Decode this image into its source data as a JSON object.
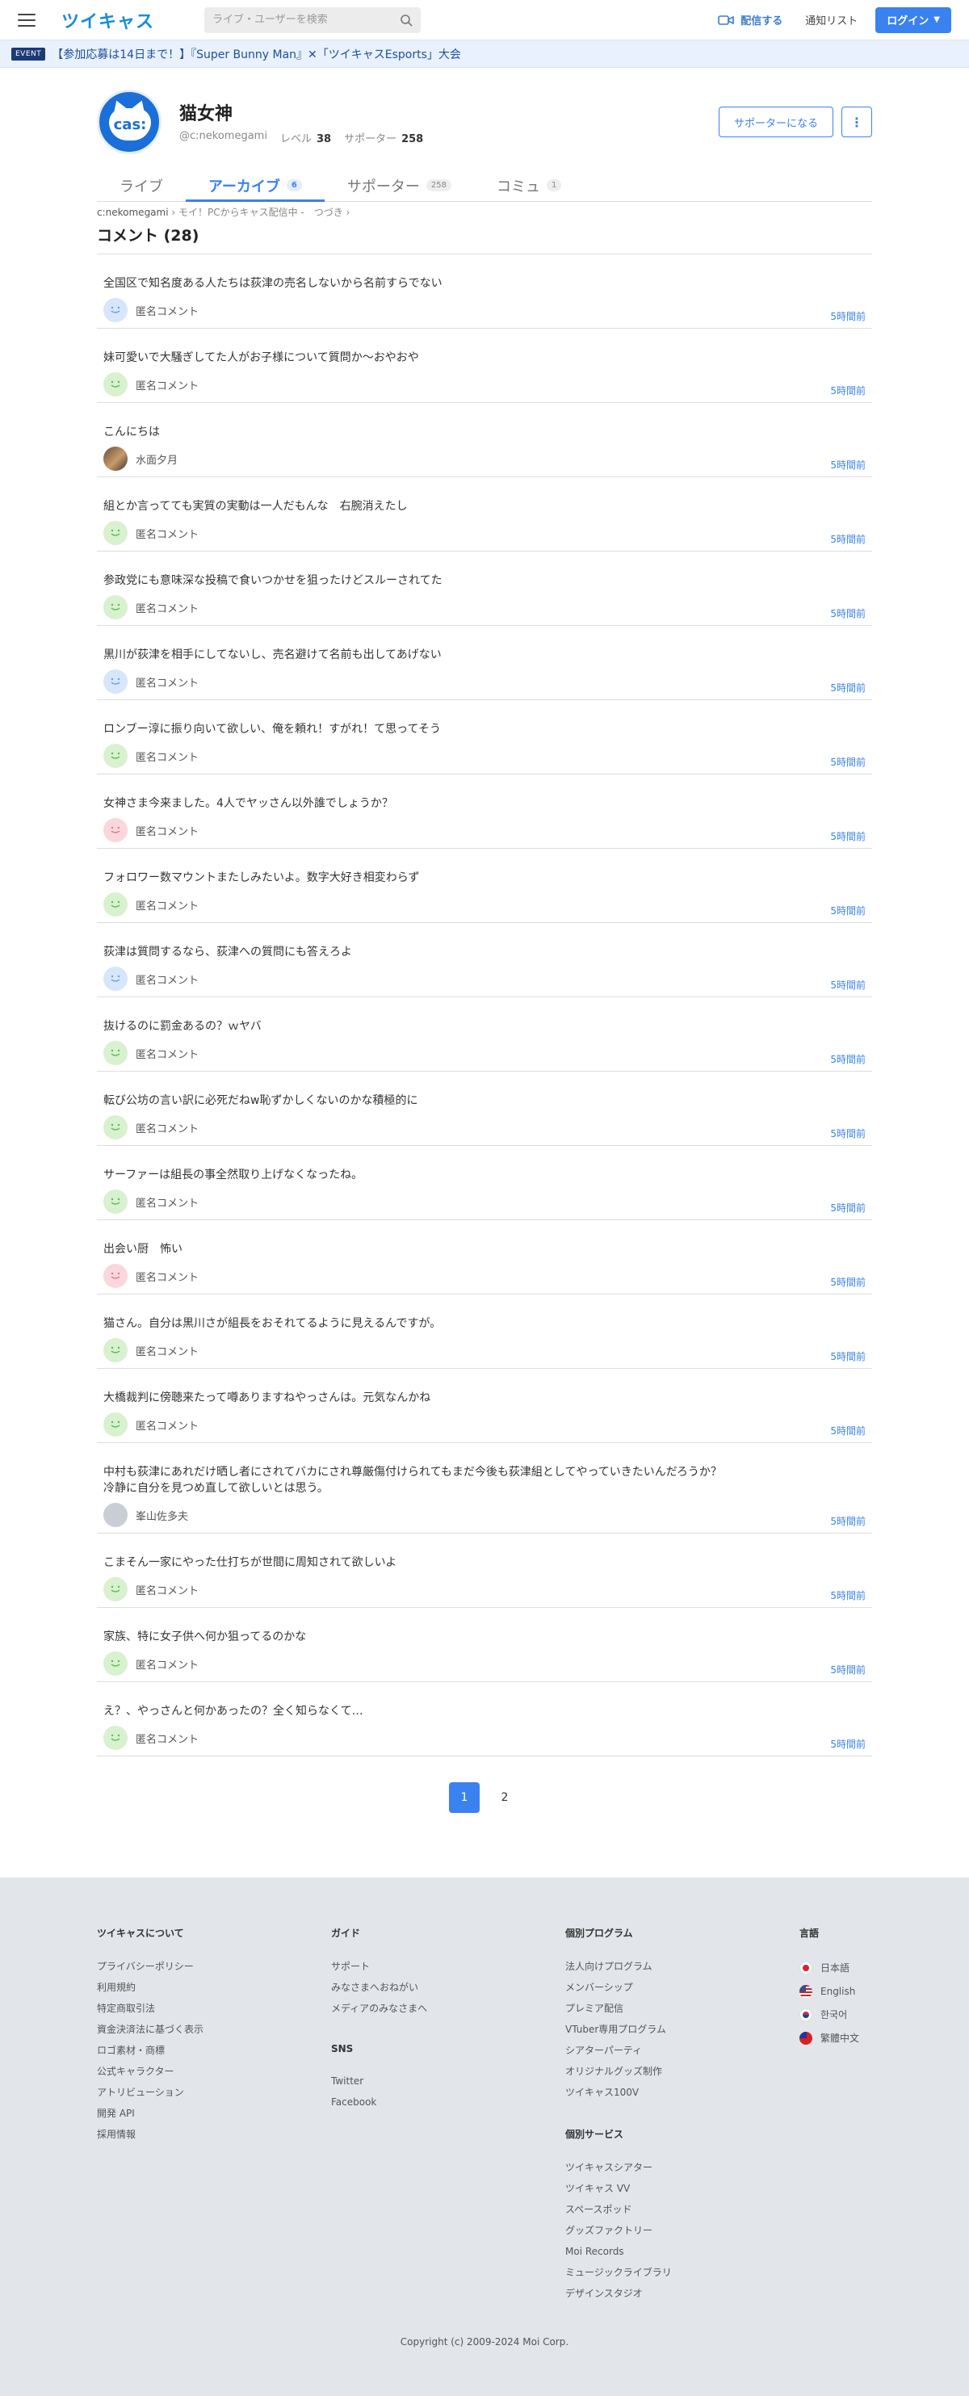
{
  "header": {
    "logo": "ツイキャス",
    "search_placeholder": "ライブ・ユーザーを検索",
    "broadcast_label": "配信する",
    "notify_label": "通知リスト",
    "login_label": "ログイン"
  },
  "event": {
    "badge": "EVENT",
    "text": "【参加応募は14日まで！】『Super Bunny Man』✕「ツイキャスEsports」大会"
  },
  "profile": {
    "avatar_text": "cas:",
    "name": "猫女神",
    "id": "@c:nekomegami",
    "level_label": "レベル",
    "level": "38",
    "supporter_label": "サポーター",
    "supporters": "258",
    "supporter_button": "サポーターになる",
    "more_button": "⋮"
  },
  "tabs": [
    {
      "label": "ライブ",
      "count": ""
    },
    {
      "label": "アーカイブ",
      "count": "6"
    },
    {
      "label": "サポーター",
      "count": "258"
    },
    {
      "label": "コミュ",
      "count": "1"
    }
  ],
  "breadcrumb": {
    "root": "c:nekomegami",
    "sep": "›",
    "item": "モイ！PCからキャス配信中 -　つづき",
    "tail": "›"
  },
  "comments_title": "コメント (28)",
  "comments": [
    {
      "text": "全国区で知名度ある人たちは荻津の売名しないから名前すらでない",
      "user": "匿名コメント",
      "avatar": "blue",
      "time": "5時間前"
    },
    {
      "text": "妹可愛いで大騒ぎしてた人がお子様について質問か〜おやおや",
      "user": "匿名コメント",
      "avatar": "green",
      "time": "5時間前"
    },
    {
      "text": "こんにちは",
      "user": "水面夕月",
      "avatar": "photo",
      "time": "5時間前"
    },
    {
      "text": "組とか言ってても実質の実動は一人だもんな　右腕消えたし",
      "user": "匿名コメント",
      "avatar": "green",
      "time": "5時間前"
    },
    {
      "text": "参政党にも意味深な投稿で食いつかせを狙ったけどスルーされてた",
      "user": "匿名コメント",
      "avatar": "green",
      "time": "5時間前"
    },
    {
      "text": "黒川が荻津を相手にしてないし、売名避けて名前も出してあげない",
      "user": "匿名コメント",
      "avatar": "blue",
      "time": "5時間前"
    },
    {
      "text": "ロンブー淳に振り向いて欲しい、俺を頼れ！すがれ！て思ってそう",
      "user": "匿名コメント",
      "avatar": "green",
      "time": "5時間前"
    },
    {
      "text": "女神さま今来ました。4人でヤッさん以外誰でしょうか？",
      "user": "匿名コメント",
      "avatar": "pink",
      "time": "5時間前"
    },
    {
      "text": "フォロワー数マウントまたしみたいよ。数字大好き相変わらず",
      "user": "匿名コメント",
      "avatar": "green",
      "time": "5時間前"
    },
    {
      "text": "荻津は質問するなら、荻津への質問にも答えろよ",
      "user": "匿名コメント",
      "avatar": "blue",
      "time": "5時間前"
    },
    {
      "text": "抜けるのに罰金あるの？ｗヤバ",
      "user": "匿名コメント",
      "avatar": "green",
      "time": "5時間前"
    },
    {
      "text": "転び公坊の言い訳に必死だねw恥ずかしくないのかな積極的に",
      "user": "匿名コメント",
      "avatar": "green",
      "time": "5時間前"
    },
    {
      "text": "サーファーは組長の事全然取り上げなくなったね。",
      "user": "匿名コメント",
      "avatar": "green",
      "time": "5時間前"
    },
    {
      "text": "出会い厨　怖い",
      "user": "匿名コメント",
      "avatar": "pink",
      "time": "5時間前"
    },
    {
      "text": "猫さん。自分は黒川さが組長をおそれてるように見えるんですが。",
      "user": "匿名コメント",
      "avatar": "green",
      "time": "5時間前"
    },
    {
      "text": "大橋裁判に傍聴来たって噂ありますねやっさんは。元気なんかね",
      "user": "匿名コメント",
      "avatar": "green",
      "time": "5時間前"
    },
    {
      "text": "中村も荻津にあれだけ晒し者にされてバカにされ尊厳傷付けられてもまだ今後も荻津組としてやっていきたいんだろうか？\n冷静に自分を見つめ直して欲しいとは思う。",
      "user": "峯山佐多夫",
      "avatar": "gray",
      "time": "5時間前",
      "tall": true
    },
    {
      "text": "こまそん一家にやった仕打ちが世間に周知されて欲しいよ",
      "user": "匿名コメント",
      "avatar": "green",
      "time": "5時間前"
    },
    {
      "text": "家族、特に女子供へ何か狙ってるのかな",
      "user": "匿名コメント",
      "avatar": "green",
      "time": "5時間前"
    },
    {
      "text": "え？、やっさんと何かあったの？全く知らなくて…",
      "user": "匿名コメント",
      "avatar": "green",
      "time": "5時間前"
    }
  ],
  "pagination": [
    "1",
    "2"
  ],
  "footer": {
    "about": {
      "heading": "ツイキャスについて",
      "links": [
        "プライバシーポリシー",
        "利用規約",
        "特定商取引法",
        "資金決済法に基づく表示",
        "ロゴ素材・商標",
        "公式キャラクター",
        "アトリビューション",
        "開発 API",
        "採用情報"
      ]
    },
    "guide": {
      "heading": "ガイド",
      "links": [
        "サポート",
        "みなさまへおねがい",
        "メディアのみなさまへ"
      ]
    },
    "sns": {
      "heading": "SNS",
      "links": [
        "Twitter",
        "Facebook"
      ]
    },
    "programs": {
      "heading": "個別プログラム",
      "links": [
        "法人向けプログラム",
        "メンバーシップ",
        "プレミア配信",
        "VTuber専用プログラム",
        "シアターパーティ",
        "オリジナルグッズ制作",
        "ツイキャス100V"
      ]
    },
    "services": {
      "heading": "個別サービス",
      "links": [
        "ツイキャスシアター",
        "ツイキャス VV",
        "スペースポッド",
        "グッズファクトリー",
        "Moi Records",
        "ミュージックライブラリ",
        "デザインスタジオ"
      ]
    },
    "languages": {
      "heading": "言語",
      "items": [
        {
          "label": "日本語",
          "flag": "jp"
        },
        {
          "label": "English",
          "flag": "us"
        },
        {
          "label": "한국어",
          "flag": "kr"
        },
        {
          "label": "繁體中文",
          "flag": "tw"
        }
      ]
    },
    "copyright": "Copyright (c) 2009-2024 Moi Corp."
  }
}
